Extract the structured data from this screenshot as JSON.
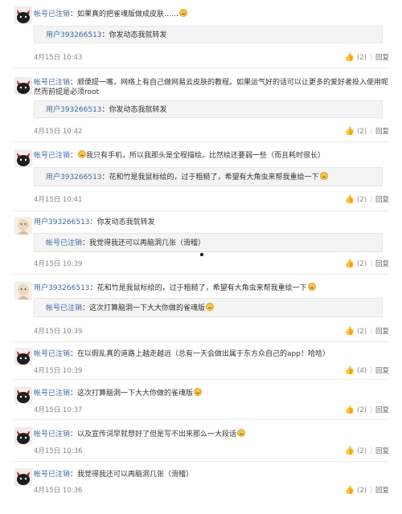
{
  "like_icon": "thumbs-up-icon",
  "reply_label": "回复",
  "sep": "|",
  "comments": [
    {
      "user": "帐号已注销",
      "colon": "：",
      "text": "如果真的把雀魂版做成皮肤……",
      "avatar": "black",
      "quote": {
        "user": "用户393266513",
        "text": "：你发动态我就转发"
      },
      "time": "4月15日 10:43",
      "likes": "(2)"
    },
    {
      "user": "帐号已注销",
      "colon": "：",
      "text": "顺便提一嘴，网络上有自己做网易云皮肤的教程。如果运气好的话可以让更多的爱好者投入使用呢",
      "text2": "然而前提是必须root",
      "avatar": "black",
      "quote": {
        "user": "用户393266513",
        "text": "：你发动态我就转发"
      },
      "time": "4月15日 10:42",
      "likes": "(2)"
    },
    {
      "user": "帐号已注销",
      "colon": "：",
      "text": "我只有手机，所以我那头是全程描绘。比然绘还要弱一些（而且耗时很长）",
      "avatar": "black",
      "quote": {
        "user": "用户393266513",
        "text": "：花和竹是我鼠标绘的，过于粗糙了，希望有大角虫来帮我重绘一下"
      },
      "time": "4月15日 10:41",
      "likes": "(2)"
    },
    {
      "user": "用户393266513",
      "colon": "：",
      "text": "你发动态我就转发",
      "avatar": "light",
      "quote": {
        "user": "帐号已注销",
        "text": "：我觉得我还可以再脑洞几张（滑稽）"
      },
      "time": "4月15日 10:39",
      "likes": "(2)"
    },
    {
      "user": "用户393266513",
      "colon": "：",
      "text": "花和竹是我鼠标绘的，过于粗糙了，希望有大角虫来帮我重绘一下",
      "avatar": "light",
      "quote": {
        "user": "帐号已注销",
        "text": "：这次打算脑洞一下大大你做的雀魂版"
      },
      "time": "4月15日 10:39",
      "likes": "(2)"
    },
    {
      "user": "帐号已注销",
      "colon": "：",
      "text": "在以假乱真的道路上越走越远（总有一天会做出属于东方众自己的app！哈哈）",
      "avatar": "black",
      "time": "4月15日 10:39",
      "likes": "(4)"
    },
    {
      "user": "帐号已注销",
      "colon": "：",
      "text": "这次打算脑洞一下大大你做的雀魂版",
      "avatar": "black",
      "time": "4月15日 10:37",
      "likes": "(2)"
    },
    {
      "user": "帐号已注销",
      "colon": "：",
      "text": "以及宣传词早就想好了但是写不出来那么一大段话",
      "avatar": "black",
      "time": "4月15日 10:36",
      "likes": "(2)"
    },
    {
      "user": "帐号已注销",
      "colon": "：",
      "text": "我觉得我还可以再脑洞几张（滑稽）",
      "avatar": "black",
      "time": "4月15日 10:36",
      "likes": "(2)"
    }
  ]
}
